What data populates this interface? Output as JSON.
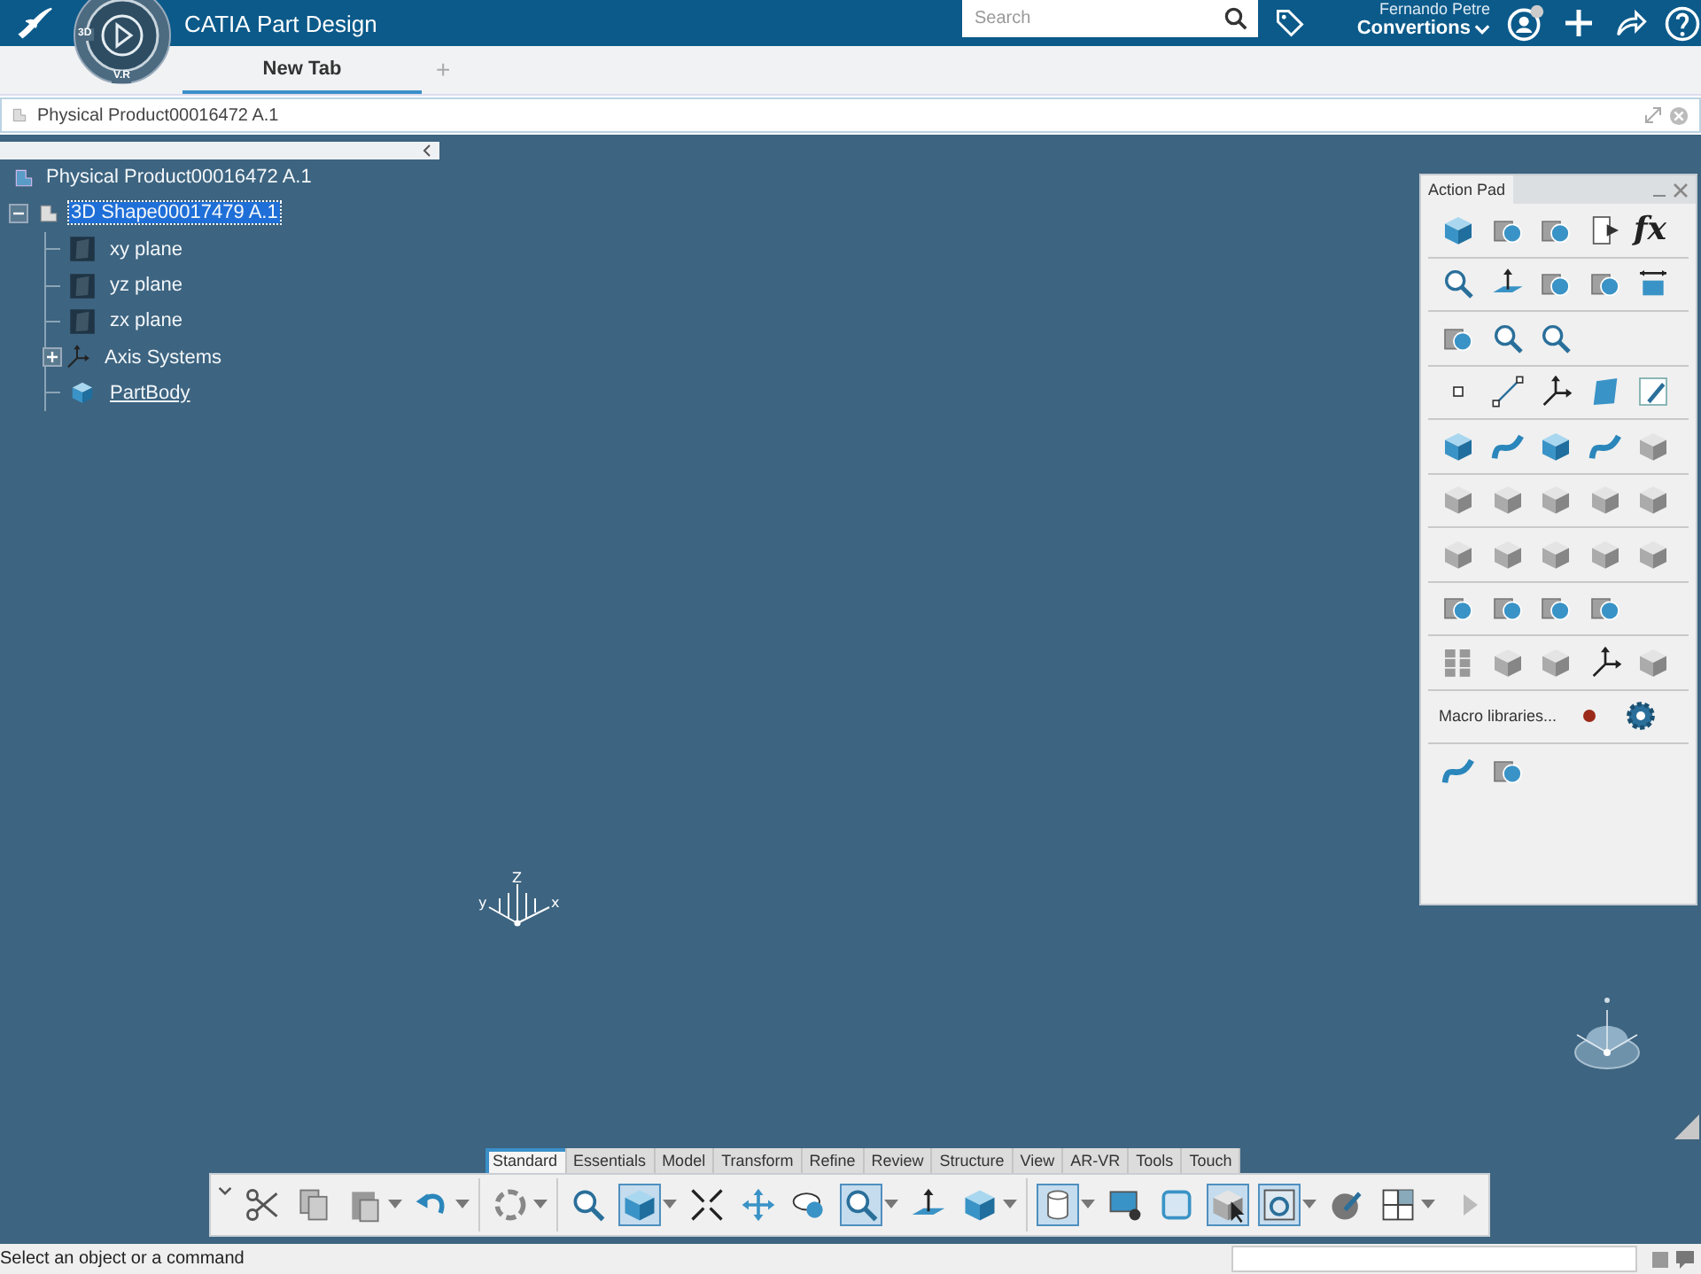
{
  "top_bar": {
    "title": "**CATIA** Part Design",
    "compass": {
      "labels": [
        "3D",
        "V.R"
      ]
    },
    "search": {
      "placeholder": "Search"
    },
    "user": {
      "name": "Fernando Petre",
      "space": "Convertions"
    }
  },
  "tabs": [
    {
      "label": "New Tab",
      "selected": true
    }
  ],
  "add_tab": "+",
  "document": {
    "title": "Physical Product00016472 A.1"
  },
  "tree": {
    "label": "Physical Product00016472 A.1",
    "kind": "product",
    "selected": false,
    "in_work": false,
    "children": [
      {
        "label": "3D Shape00017479 A.1",
        "kind": "shape",
        "selected": true,
        "in_work": false,
        "expanded": true,
        "children": [
          {
            "label": "xy plane",
            "kind": "plane",
            "selected": false,
            "in_work": false
          },
          {
            "label": "yz plane",
            "kind": "plane",
            "selected": false,
            "in_work": false
          },
          {
            "label": "zx plane",
            "kind": "plane",
            "selected": false,
            "in_work": false
          },
          {
            "label": "Axis Systems",
            "kind": "axis",
            "selected": false,
            "in_work": false,
            "expanded": false
          },
          {
            "label": "PartBody",
            "kind": "body",
            "selected": false,
            "in_work": true
          }
        ]
      }
    ]
  },
  "action_pad": {
    "title": "Action Pad",
    "formula": "fx",
    "macro_label": "Macro libraries..."
  },
  "triad": {
    "labels": [
      "Z",
      "y",
      "x"
    ]
  },
  "toolbar": {
    "tabs": [
      {
        "label": "Standard",
        "selected": true
      },
      {
        "label": "Essentials",
        "selected": false
      },
      {
        "label": "Model",
        "selected": false
      },
      {
        "label": "Transform",
        "selected": false
      },
      {
        "label": "Refine",
        "selected": false
      },
      {
        "label": "Review",
        "selected": false
      },
      {
        "label": "Structure",
        "selected": false
      },
      {
        "label": "View",
        "selected": false
      },
      {
        "label": "AR-VR",
        "selected": false
      },
      {
        "label": "Tools",
        "selected": false
      },
      {
        "label": "Touch",
        "selected": false
      }
    ],
    "buttons": [
      {
        "kind": "scissors",
        "on": false,
        "dropdown": false
      },
      {
        "kind": "copy",
        "on": false,
        "dropdown": false
      },
      {
        "kind": "paste",
        "on": false,
        "dropdown": true
      },
      {
        "kind": "undo",
        "on": false,
        "dropdown": true
      },
      {
        "kind": "separator"
      },
      {
        "kind": "cycle",
        "on": false,
        "dropdown": true
      },
      {
        "kind": "separator"
      },
      {
        "kind": "mag",
        "on": false,
        "dropdown": false
      },
      {
        "kind": "cube",
        "on": true,
        "dropdown": true
      },
      {
        "kind": "compress",
        "on": false,
        "dropdown": false
      },
      {
        "kind": "move",
        "on": false,
        "dropdown": false
      },
      {
        "kind": "hand",
        "on": false,
        "dropdown": false
      },
      {
        "kind": "mag",
        "on": true,
        "dropdown": true
      },
      {
        "kind": "plane-arrow",
        "on": false,
        "dropdown": false
      },
      {
        "kind": "cube",
        "on": false,
        "dropdown": true
      },
      {
        "kind": "separator"
      },
      {
        "kind": "cylinder",
        "on": true,
        "dropdown": true
      },
      {
        "kind": "monitor",
        "on": false,
        "dropdown": false
      },
      {
        "kind": "window",
        "on": false,
        "dropdown": false
      },
      {
        "kind": "cursor",
        "on": true,
        "dropdown": false
      },
      {
        "kind": "refresh",
        "on": true,
        "dropdown": true
      },
      {
        "kind": "sphere",
        "on": false,
        "dropdown": false
      },
      {
        "kind": "panes",
        "on": false,
        "dropdown": true
      }
    ]
  },
  "status_bar": {
    "message": "Select an object or a command"
  }
}
